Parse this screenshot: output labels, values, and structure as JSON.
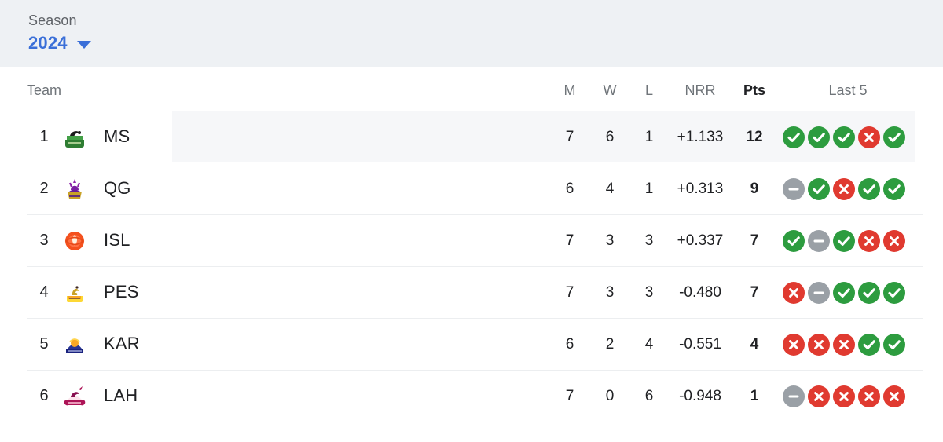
{
  "season": {
    "label": "Season",
    "value": "2024",
    "caret_icon": "chevron-down-icon",
    "accent_color": "#3a6fd8",
    "banner_color": "#eef1f4"
  },
  "table": {
    "columns": {
      "team": "Team",
      "matches": "M",
      "wins": "W",
      "losses": "L",
      "nrr": "NRR",
      "points": "Pts",
      "last5": "Last 5"
    },
    "result_colors": {
      "win": "#2d9c3f",
      "loss": "#e03a30",
      "no_result": "#9aa0a6"
    },
    "rows": [
      {
        "rank": "1",
        "team": "MS",
        "logo": "multan-sultans-logo",
        "matches": "7",
        "wins": "6",
        "losses": "1",
        "nrr": "+1.133",
        "points": "12",
        "last5": [
          "win",
          "win",
          "win",
          "loss",
          "win"
        ],
        "highlighted": true
      },
      {
        "rank": "2",
        "team": "QG",
        "logo": "quetta-gladiators-logo",
        "matches": "6",
        "wins": "4",
        "losses": "1",
        "nrr": "+0.313",
        "points": "9",
        "last5": [
          "no_result",
          "win",
          "loss",
          "win",
          "win"
        ],
        "highlighted": false
      },
      {
        "rank": "3",
        "team": "ISL",
        "logo": "islamabad-united-logo",
        "matches": "7",
        "wins": "3",
        "losses": "3",
        "nrr": "+0.337",
        "points": "7",
        "last5": [
          "win",
          "no_result",
          "win",
          "loss",
          "loss"
        ],
        "highlighted": false
      },
      {
        "rank": "4",
        "team": "PES",
        "logo": "peshawar-zalmi-logo",
        "matches": "7",
        "wins": "3",
        "losses": "3",
        "nrr": "-0.480",
        "points": "7",
        "last5": [
          "loss",
          "no_result",
          "win",
          "win",
          "win"
        ],
        "highlighted": false
      },
      {
        "rank": "5",
        "team": "KAR",
        "logo": "karachi-kings-logo",
        "matches": "6",
        "wins": "2",
        "losses": "4",
        "nrr": "-0.551",
        "points": "4",
        "last5": [
          "loss",
          "loss",
          "loss",
          "win",
          "win"
        ],
        "highlighted": false
      },
      {
        "rank": "6",
        "team": "LAH",
        "logo": "lahore-qalandars-logo",
        "matches": "7",
        "wins": "0",
        "losses": "6",
        "nrr": "-0.948",
        "points": "1",
        "last5": [
          "no_result",
          "loss",
          "loss",
          "loss",
          "loss"
        ],
        "highlighted": false
      }
    ]
  }
}
